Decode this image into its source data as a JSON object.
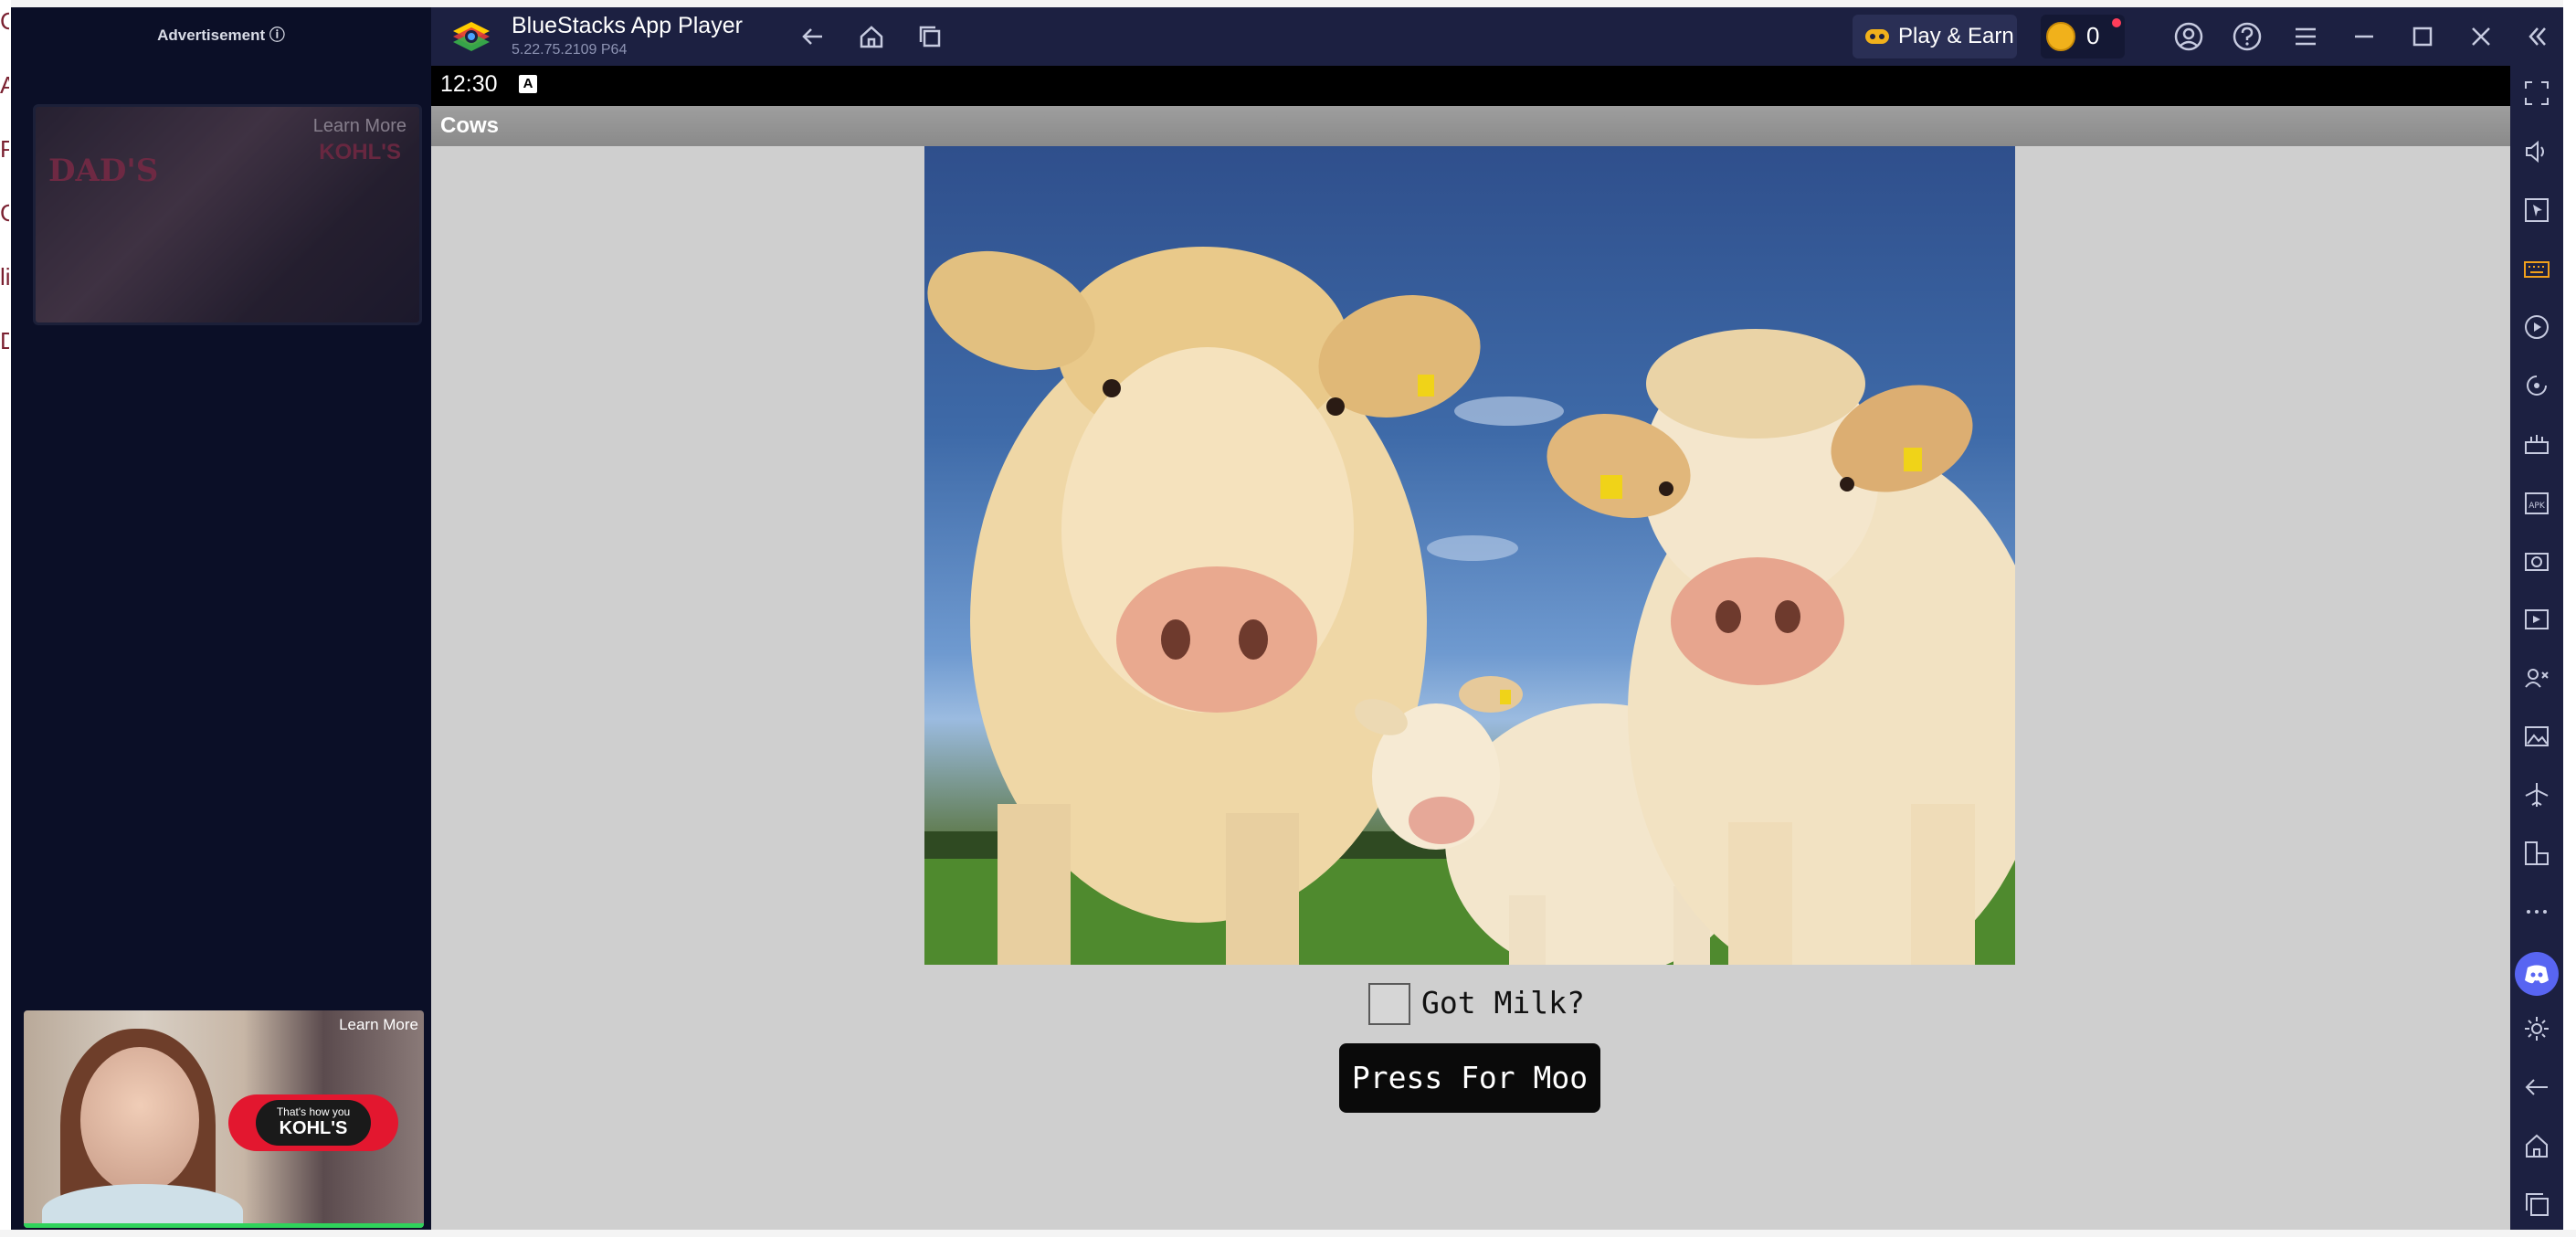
{
  "background_page": {
    "left_edge_fragments": [
      "Cy",
      "Ad",
      "Pe",
      "G",
      "li",
      "D"
    ]
  },
  "ad_panel": {
    "label": "Advertisement ⓘ",
    "top_ad": {
      "headline": "DAD'S",
      "learn_more": "Learn More",
      "brand": "KOHL'S"
    },
    "bottom_ad": {
      "learn_more": "Learn More",
      "tagline": "That's how you",
      "brand": "KOHL'S"
    }
  },
  "titlebar": {
    "app_name": "BlueStacks App Player",
    "version": "5.22.75.2109  P64",
    "play_earn_label": "Play & Earn",
    "coin_count": "0",
    "icons": [
      "back-icon",
      "home-icon",
      "recent-apps-icon",
      "account-icon",
      "help-icon",
      "menu-icon",
      "minimize-icon",
      "maximize-icon",
      "close-icon",
      "collapse-sidebar-icon"
    ]
  },
  "statusbar": {
    "time": "12:30",
    "indicator": "A"
  },
  "app": {
    "header_title": "Cows",
    "checkbox_label": "Got Milk?",
    "checkbox_checked": false,
    "button_label": "Press For Moo"
  },
  "sidebar": {
    "icons": [
      "fullscreen-icon",
      "volume-icon",
      "pointer-icon",
      "keyboard-icon",
      "macro-record-icon",
      "rotate-icon",
      "gamepad-icon",
      "apk-install-icon",
      "screenshot-icon",
      "screen-record-icon",
      "multi-instance-icon",
      "media-folder-icon",
      "airplane-mode-icon",
      "resize-icon",
      "more-icon",
      "discord-icon",
      "settings-icon",
      "android-back-icon",
      "android-home-icon",
      "android-recents-icon"
    ]
  },
  "colors": {
    "titlebar_bg": "#1c2041",
    "ad_panel_bg": "#0b0f27",
    "app_body_bg": "#cfcfcf",
    "button_bg": "#0a0a0a",
    "discord": "#5865f2",
    "coin": "#f1b11b"
  }
}
